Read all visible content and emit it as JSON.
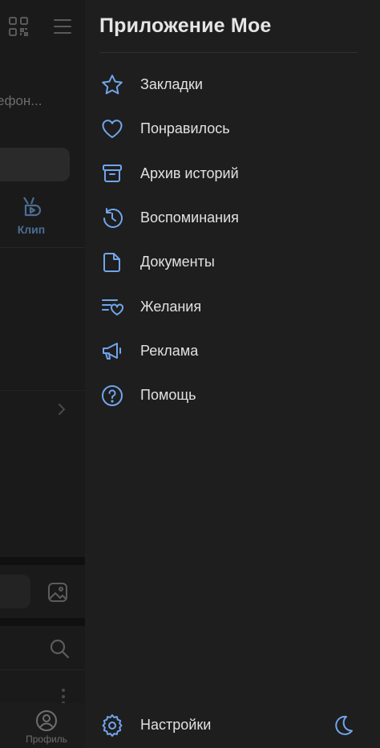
{
  "background": {
    "phone_text": "ефон...",
    "clip_label": "Клип",
    "tab_profile_label": "Профиль"
  },
  "drawer": {
    "title": "Приложение Мое",
    "accent_color": "#71a5ec",
    "items": [
      {
        "label": "Закладки",
        "icon": "star-icon"
      },
      {
        "label": "Понравилось",
        "icon": "heart-icon"
      },
      {
        "label": "Архив историй",
        "icon": "archive-icon"
      },
      {
        "label": "Воспоминания",
        "icon": "history-icon"
      },
      {
        "label": "Документы",
        "icon": "document-icon"
      },
      {
        "label": "Желания",
        "icon": "wishlist-icon"
      },
      {
        "label": "Реклама",
        "icon": "megaphone-icon"
      },
      {
        "label": "Помощь",
        "icon": "help-icon"
      }
    ],
    "footer": {
      "settings_label": "Настройки",
      "settings_icon": "gear-icon",
      "theme_icon": "moon-icon"
    }
  }
}
